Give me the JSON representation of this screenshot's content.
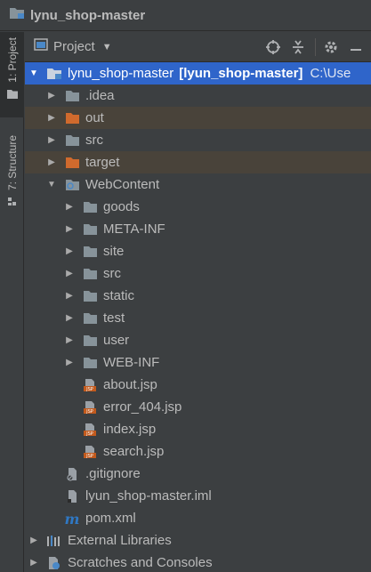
{
  "window": {
    "title": "lynu_shop-master"
  },
  "left_strip": {
    "project_tab": "1: Project",
    "structure_tab": "7: Structure"
  },
  "panel": {
    "title": "Project",
    "tools": [
      "locate-icon",
      "collapse-all-icon",
      "gear-icon",
      "hide-icon"
    ]
  },
  "tree": {
    "root": {
      "name": "lynu_shop-master",
      "module": "[lyun_shop-master]",
      "path": "C:\\Use"
    },
    "idea": ".idea",
    "out": "out",
    "src": "src",
    "target": "target",
    "webcontent": "WebContent",
    "wc_children": [
      "goods",
      "META-INF",
      "site",
      "src",
      "static",
      "test",
      "user",
      "WEB-INF"
    ],
    "jsp_files": [
      "about.jsp",
      "error_404.jsp",
      "index.jsp",
      "search.jsp"
    ],
    "gitignore": ".gitignore",
    "iml": "lyun_shop-master.iml",
    "pom": "pom.xml",
    "external": "External Libraries",
    "scratches": "Scratches and Consoles"
  },
  "colors": {
    "background": "#3c3f41",
    "selection": "#2f65ca",
    "excluded_bg": "#49433a",
    "folder": "#87939a",
    "excluded_folder": "#d06a2d",
    "jsp": "#c25a1d",
    "maven": "#2f78c4"
  }
}
